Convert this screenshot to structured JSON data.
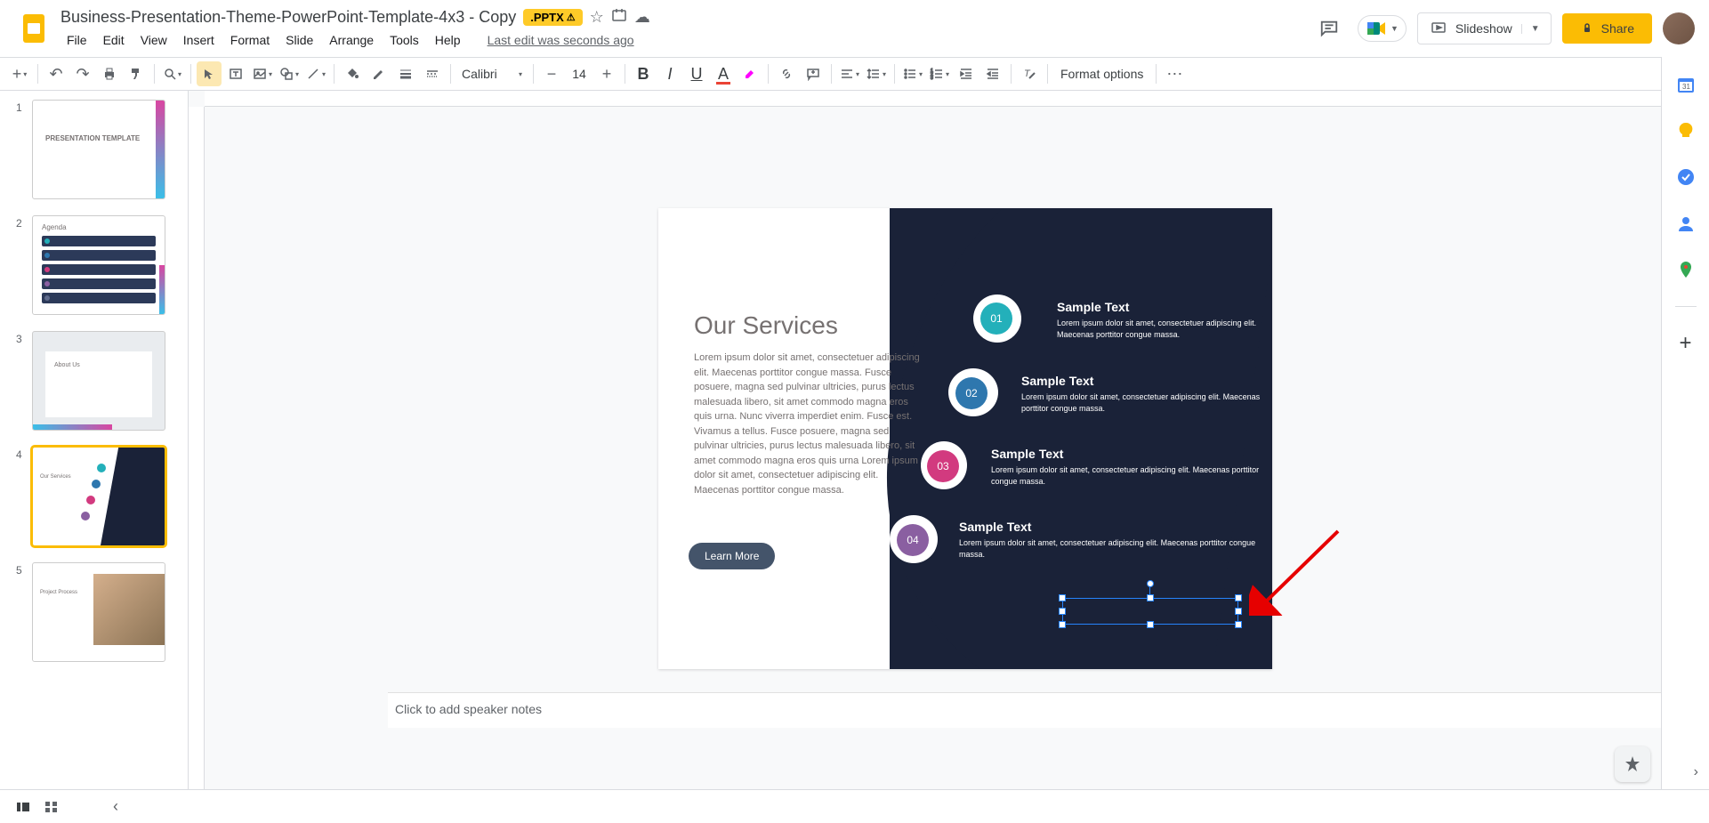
{
  "header": {
    "doc_title": "Business-Presentation-Theme-PowerPoint-Template-4x3 - Copy",
    "badge": ".PPTX",
    "last_edit": "Last edit was seconds ago",
    "slideshow": "Slideshow",
    "share": "Share"
  },
  "menu": {
    "file": "File",
    "edit": "Edit",
    "view": "View",
    "insert": "Insert",
    "format": "Format",
    "slide": "Slide",
    "arrange": "Arrange",
    "tools": "Tools",
    "help": "Help"
  },
  "toolbar": {
    "font_name": "Calibri",
    "font_size": "14",
    "format_options": "Format options"
  },
  "filmstrip": {
    "nums": [
      "1",
      "2",
      "3",
      "4",
      "5"
    ],
    "slide1_title": "PRESENTATION TEMPLATE",
    "slide2_title": "Agenda",
    "slide3_title": "About Us",
    "slide4_title": "Our Services",
    "slide5_title": "Project Process"
  },
  "slide": {
    "title": "Our Services",
    "body": "Lorem ipsum dolor sit amet, consectetuer adipiscing elit. Maecenas porttitor congue massa. Fusce posuere, magna sed pulvinar ultricies, purus lectus malesuada libero, sit amet commodo magna eros quis urna. Nunc viverra imperdiet enim. Fusce est. Vivamus a tellus. Fusce posuere, magna sed pulvinar ultricies, purus lectus malesuada libero, sit amet commodo magna eros quis urna Lorem ipsum dolor sit amet, consectetuer adipiscing elit. Maecenas porttitor congue massa.",
    "learn_more": "Learn More",
    "items": [
      {
        "num": "01",
        "title": "Sample Text",
        "desc": "Lorem ipsum dolor sit amet, consectetuer adipiscing elit. Maecenas porttitor congue massa."
      },
      {
        "num": "02",
        "title": "Sample Text",
        "desc": "Lorem ipsum dolor sit amet, consectetuer adipiscing elit. Maecenas porttitor congue massa."
      },
      {
        "num": "03",
        "title": "Sample Text",
        "desc": "Lorem ipsum dolor sit amet, consectetuer adipiscing elit. Maecenas porttitor congue massa."
      },
      {
        "num": "04",
        "title": "Sample Text",
        "desc": "Lorem ipsum dolor sit amet, consectetuer adipiscing elit. Maecenas porttitor congue massa."
      }
    ]
  },
  "speaker_notes": {
    "placeholder": "Click to add speaker notes"
  }
}
